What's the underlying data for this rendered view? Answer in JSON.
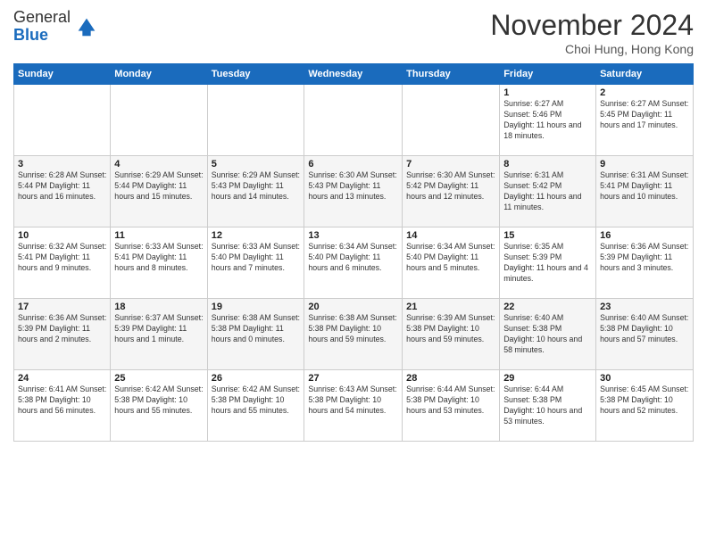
{
  "header": {
    "logo_general": "General",
    "logo_blue": "Blue",
    "month_title": "November 2024",
    "subtitle": "Choi Hung, Hong Kong"
  },
  "calendar": {
    "days_of_week": [
      "Sunday",
      "Monday",
      "Tuesday",
      "Wednesday",
      "Thursday",
      "Friday",
      "Saturday"
    ],
    "weeks": [
      [
        {
          "day": "",
          "info": ""
        },
        {
          "day": "",
          "info": ""
        },
        {
          "day": "",
          "info": ""
        },
        {
          "day": "",
          "info": ""
        },
        {
          "day": "",
          "info": ""
        },
        {
          "day": "1",
          "info": "Sunrise: 6:27 AM\nSunset: 5:46 PM\nDaylight: 11 hours and 18 minutes."
        },
        {
          "day": "2",
          "info": "Sunrise: 6:27 AM\nSunset: 5:45 PM\nDaylight: 11 hours and 17 minutes."
        }
      ],
      [
        {
          "day": "3",
          "info": "Sunrise: 6:28 AM\nSunset: 5:44 PM\nDaylight: 11 hours and 16 minutes."
        },
        {
          "day": "4",
          "info": "Sunrise: 6:29 AM\nSunset: 5:44 PM\nDaylight: 11 hours and 15 minutes."
        },
        {
          "day": "5",
          "info": "Sunrise: 6:29 AM\nSunset: 5:43 PM\nDaylight: 11 hours and 14 minutes."
        },
        {
          "day": "6",
          "info": "Sunrise: 6:30 AM\nSunset: 5:43 PM\nDaylight: 11 hours and 13 minutes."
        },
        {
          "day": "7",
          "info": "Sunrise: 6:30 AM\nSunset: 5:42 PM\nDaylight: 11 hours and 12 minutes."
        },
        {
          "day": "8",
          "info": "Sunrise: 6:31 AM\nSunset: 5:42 PM\nDaylight: 11 hours and 11 minutes."
        },
        {
          "day": "9",
          "info": "Sunrise: 6:31 AM\nSunset: 5:41 PM\nDaylight: 11 hours and 10 minutes."
        }
      ],
      [
        {
          "day": "10",
          "info": "Sunrise: 6:32 AM\nSunset: 5:41 PM\nDaylight: 11 hours and 9 minutes."
        },
        {
          "day": "11",
          "info": "Sunrise: 6:33 AM\nSunset: 5:41 PM\nDaylight: 11 hours and 8 minutes."
        },
        {
          "day": "12",
          "info": "Sunrise: 6:33 AM\nSunset: 5:40 PM\nDaylight: 11 hours and 7 minutes."
        },
        {
          "day": "13",
          "info": "Sunrise: 6:34 AM\nSunset: 5:40 PM\nDaylight: 11 hours and 6 minutes."
        },
        {
          "day": "14",
          "info": "Sunrise: 6:34 AM\nSunset: 5:40 PM\nDaylight: 11 hours and 5 minutes."
        },
        {
          "day": "15",
          "info": "Sunrise: 6:35 AM\nSunset: 5:39 PM\nDaylight: 11 hours and 4 minutes."
        },
        {
          "day": "16",
          "info": "Sunrise: 6:36 AM\nSunset: 5:39 PM\nDaylight: 11 hours and 3 minutes."
        }
      ],
      [
        {
          "day": "17",
          "info": "Sunrise: 6:36 AM\nSunset: 5:39 PM\nDaylight: 11 hours and 2 minutes."
        },
        {
          "day": "18",
          "info": "Sunrise: 6:37 AM\nSunset: 5:39 PM\nDaylight: 11 hours and 1 minute."
        },
        {
          "day": "19",
          "info": "Sunrise: 6:38 AM\nSunset: 5:38 PM\nDaylight: 11 hours and 0 minutes."
        },
        {
          "day": "20",
          "info": "Sunrise: 6:38 AM\nSunset: 5:38 PM\nDaylight: 10 hours and 59 minutes."
        },
        {
          "day": "21",
          "info": "Sunrise: 6:39 AM\nSunset: 5:38 PM\nDaylight: 10 hours and 59 minutes."
        },
        {
          "day": "22",
          "info": "Sunrise: 6:40 AM\nSunset: 5:38 PM\nDaylight: 10 hours and 58 minutes."
        },
        {
          "day": "23",
          "info": "Sunrise: 6:40 AM\nSunset: 5:38 PM\nDaylight: 10 hours and 57 minutes."
        }
      ],
      [
        {
          "day": "24",
          "info": "Sunrise: 6:41 AM\nSunset: 5:38 PM\nDaylight: 10 hours and 56 minutes."
        },
        {
          "day": "25",
          "info": "Sunrise: 6:42 AM\nSunset: 5:38 PM\nDaylight: 10 hours and 55 minutes."
        },
        {
          "day": "26",
          "info": "Sunrise: 6:42 AM\nSunset: 5:38 PM\nDaylight: 10 hours and 55 minutes."
        },
        {
          "day": "27",
          "info": "Sunrise: 6:43 AM\nSunset: 5:38 PM\nDaylight: 10 hours and 54 minutes."
        },
        {
          "day": "28",
          "info": "Sunrise: 6:44 AM\nSunset: 5:38 PM\nDaylight: 10 hours and 53 minutes."
        },
        {
          "day": "29",
          "info": "Sunrise: 6:44 AM\nSunset: 5:38 PM\nDaylight: 10 hours and 53 minutes."
        },
        {
          "day": "30",
          "info": "Sunrise: 6:45 AM\nSunset: 5:38 PM\nDaylight: 10 hours and 52 minutes."
        }
      ]
    ]
  }
}
